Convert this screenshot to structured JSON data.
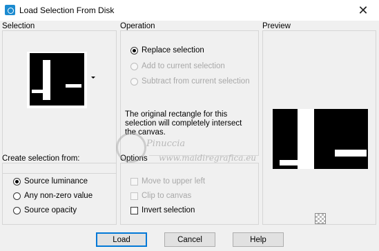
{
  "window": {
    "title": "Load Selection From Disk",
    "close_glyph": "✕"
  },
  "selection": {
    "title": "Selection"
  },
  "operation": {
    "title": "Operation",
    "options": [
      {
        "label": "Replace selection",
        "checked": true,
        "disabled": false
      },
      {
        "label": "Add to current selection",
        "checked": false,
        "disabled": true
      },
      {
        "label": "Subtract from current selection",
        "checked": false,
        "disabled": true
      }
    ],
    "info": "The original rectangle for this selection will completely intersect the canvas."
  },
  "preview": {
    "title": "Preview"
  },
  "create_from": {
    "title": "Create selection from:",
    "options": [
      {
        "label": "Source luminance",
        "checked": true
      },
      {
        "label": "Any non-zero value",
        "checked": false
      },
      {
        "label": "Source opacity",
        "checked": false
      }
    ]
  },
  "options": {
    "title": "Options",
    "items": [
      {
        "label": "Move to upper left",
        "checked": false,
        "disabled": true
      },
      {
        "label": "Clip to canvas",
        "checked": false,
        "disabled": true
      },
      {
        "label": "Invert selection",
        "checked": false,
        "disabled": false
      }
    ]
  },
  "buttons": {
    "load": "Load",
    "cancel": "Cancel",
    "help": "Help"
  },
  "watermark": {
    "name": "Pinuccia",
    "url": "www.maidiregrafica.eu"
  },
  "icons": {
    "app": "app-icon",
    "close": "close-icon",
    "dropdown": "chevron-down-icon",
    "checker": "transparency-checker-icon"
  },
  "colors": {
    "accent": "#0078d7",
    "background": "#f0f0f0",
    "titlebar": "#ffffff"
  }
}
